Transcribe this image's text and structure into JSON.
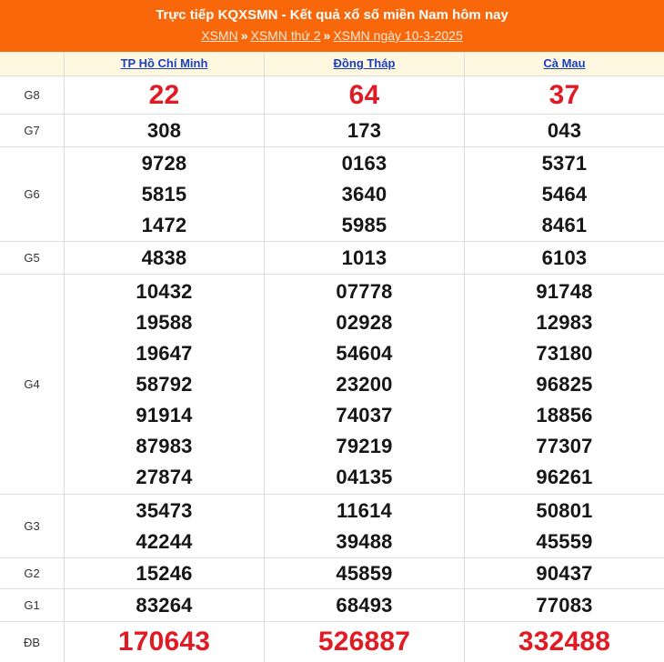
{
  "header": {
    "title": "Trực tiếp KQXSMN - Kết quả xổ số miền Nam hôm nay",
    "breadcrumb": {
      "items": [
        "XSMN",
        "XSMN thứ 2",
        "XSMN ngày 10-3-2025"
      ],
      "separator": "»"
    }
  },
  "results": {
    "provinces": [
      "TP Hồ Chí Minh",
      "Đồng Tháp",
      "Cà Mau"
    ],
    "prizes": [
      {
        "label": "G8",
        "values": [
          [
            "22"
          ],
          [
            "64"
          ],
          [
            "37"
          ]
        ]
      },
      {
        "label": "G7",
        "values": [
          [
            "308"
          ],
          [
            "173"
          ],
          [
            "043"
          ]
        ]
      },
      {
        "label": "G6",
        "values": [
          [
            "9728",
            "5815",
            "1472"
          ],
          [
            "0163",
            "3640",
            "5985"
          ],
          [
            "5371",
            "5464",
            "8461"
          ]
        ]
      },
      {
        "label": "G5",
        "values": [
          [
            "4838"
          ],
          [
            "1013"
          ],
          [
            "6103"
          ]
        ]
      },
      {
        "label": "G4",
        "values": [
          [
            "10432",
            "19588",
            "19647",
            "58792",
            "91914",
            "87983",
            "27874"
          ],
          [
            "07778",
            "02928",
            "54604",
            "23200",
            "74037",
            "79219",
            "04135"
          ],
          [
            "91748",
            "12983",
            "73180",
            "96825",
            "18856",
            "77307",
            "96261"
          ]
        ]
      },
      {
        "label": "G3",
        "values": [
          [
            "35473",
            "42244"
          ],
          [
            "11614",
            "39488"
          ],
          [
            "50801",
            "45559"
          ]
        ]
      },
      {
        "label": "G2",
        "values": [
          [
            "15246"
          ],
          [
            "45859"
          ],
          [
            "90437"
          ]
        ]
      },
      {
        "label": "G1",
        "values": [
          [
            "83264"
          ],
          [
            "68493"
          ],
          [
            "77083"
          ]
        ]
      },
      {
        "label": "ĐB",
        "values": [
          [
            "170643"
          ],
          [
            "526887"
          ],
          [
            "332488"
          ]
        ]
      }
    ]
  },
  "colors": {
    "header_bg": "#f8680b",
    "highlight_number": "#e01b24",
    "province_link": "#1a3fc2",
    "province_row_bg": "#fff8e1"
  }
}
